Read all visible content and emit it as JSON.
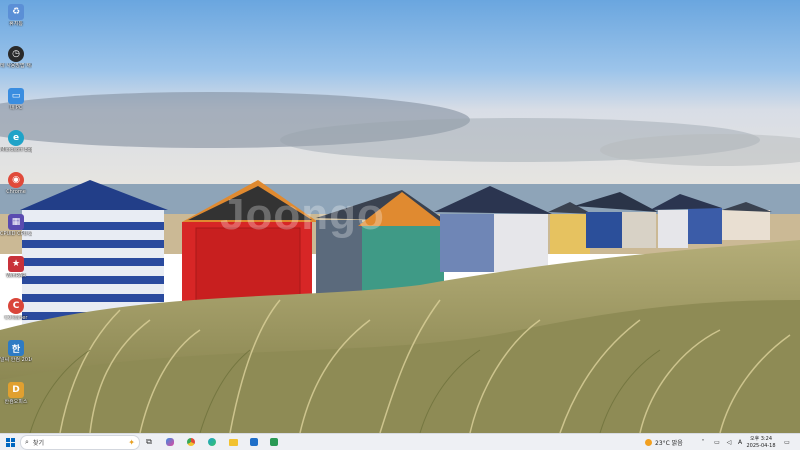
{
  "desktop_icons": [
    {
      "label": "휴지통",
      "icon": "recycle-bin-icon",
      "color": "#5b8fd6"
    },
    {
      "label": "테 사용방법 재시...",
      "icon": "clock-icon",
      "color": "#2a2a2a"
    },
    {
      "label": "내 PC",
      "icon": "pc-icon",
      "color": "#3a8de0"
    },
    {
      "label": "Microsoft Edge",
      "icon": "edge-icon",
      "color": "#1fa3c8"
    },
    {
      "label": "Chrome",
      "icon": "chrome-icon",
      "color": "#e04a3a"
    },
    {
      "label": "CPUID CPU-Z",
      "icon": "cpu-z-icon",
      "color": "#5a4bb0"
    },
    {
      "label": "WinRAR",
      "icon": "winrar-icon",
      "color": "#c8323a"
    },
    {
      "label": "CCleaner",
      "icon": "ccleaner-icon",
      "color": "#d9463a"
    },
    {
      "label": "알씨 한컴 2010",
      "icon": "hancom-icon",
      "color": "#2e7bc4"
    },
    {
      "label": "한컴오피스",
      "icon": "office-icon",
      "color": "#e0a030"
    }
  ],
  "watermark": "Joongo",
  "taskbar": {
    "search_placeholder": "찾기",
    "weather": "23°C 맑음",
    "lang": "A",
    "time": "오후 3:24",
    "date": "2025-04-18"
  },
  "colors": {
    "accent": "#0067c0",
    "taskbar_bg": "#eef0f4"
  }
}
